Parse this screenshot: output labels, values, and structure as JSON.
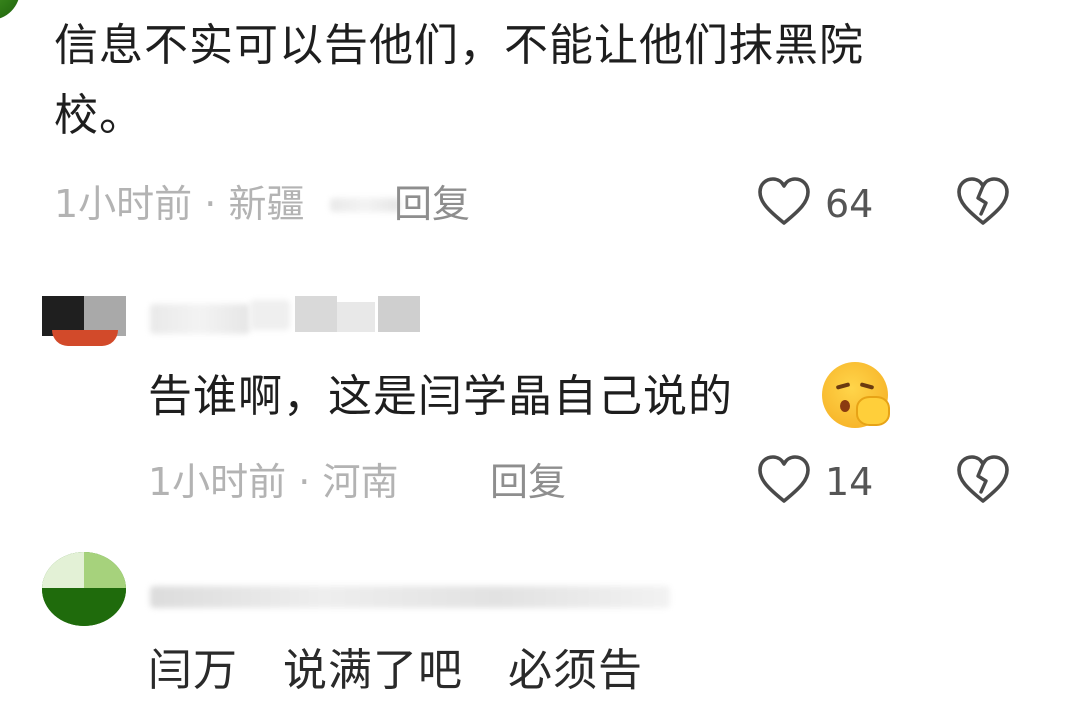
{
  "comments": [
    {
      "text": "信息不实可以告他们，不能让他们抹黑院校。",
      "line1": "信息不实可以告他们，不能让他们抹黑院",
      "line2": "校。",
      "time": "1小时前",
      "location": "新疆",
      "reply_label": "回复",
      "likes": "64"
    },
    {
      "text": "告谁啊，这是闫学晶自己说的",
      "time": "1小时前",
      "location": "河南",
      "reply_label": "回复",
      "likes": "14",
      "emoji": "shush-emoji"
    },
    {
      "text_partial": "闫万　说满了吧　必须告"
    }
  ],
  "separator": "·",
  "icons": {
    "like": "heart-outline-icon",
    "dislike": "broken-heart-icon"
  },
  "colors": {
    "text": "#1e1e1e",
    "meta": "#b3b3b3",
    "icon": "#4a4a4a"
  }
}
